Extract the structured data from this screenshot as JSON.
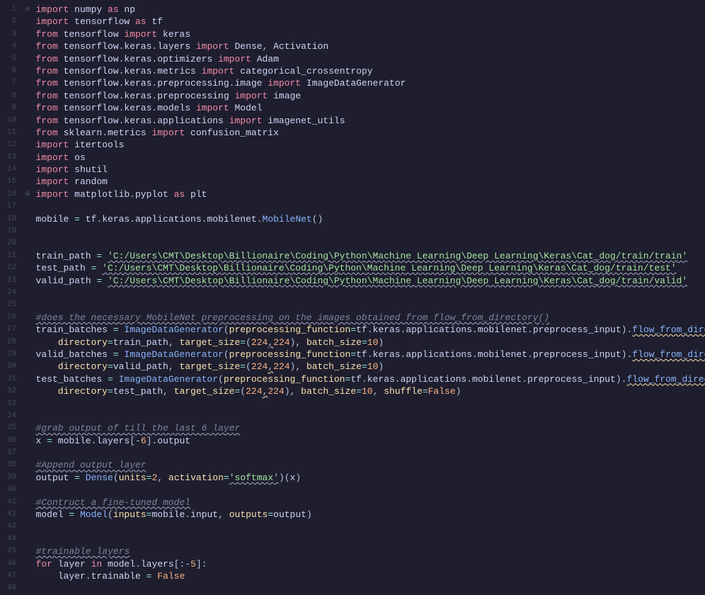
{
  "lines": [
    {
      "n": 1,
      "fold": "⊖",
      "html": "<span class='kw'>import</span> <span class='mod'>numpy</span> <span class='kw'>as</span> <span class='mod'>np</span>"
    },
    {
      "n": 2,
      "fold": "",
      "html": "<span class='kw'>import</span> <span class='mod'>tensorflow</span> <span class='kw'>as</span> <span class='mod'>tf</span>"
    },
    {
      "n": 3,
      "fold": "",
      "html": "<span class='kw'>from</span> <span class='mod'>tensorflow</span> <span class='kw'>import</span> <span class='mod'>keras</span>"
    },
    {
      "n": 4,
      "fold": "",
      "html": "<span class='kw'>from</span> <span class='mod'>tensorflow</span><span class='punc'>.</span><span class='mod'>keras</span><span class='punc'>.</span><span class='mod'>layers</span> <span class='kw'>import</span> <span class='mod'>Dense</span><span class='punc'>,</span> <span class='mod'>Activation</span>"
    },
    {
      "n": 5,
      "fold": "",
      "html": "<span class='kw'>from</span> <span class='mod'>tensorflow</span><span class='punc'>.</span><span class='mod'>keras</span><span class='punc'>.</span><span class='mod'>optimizers</span> <span class='kw'>import</span> <span class='mod'>Adam</span>"
    },
    {
      "n": 6,
      "fold": "",
      "html": "<span class='kw'>from</span> <span class='mod'>tensorflow</span><span class='punc'>.</span><span class='mod'>keras</span><span class='punc'>.</span><span class='mod'>metrics</span> <span class='kw'>import</span> <span class='mod'>categorical_crossentropy</span>"
    },
    {
      "n": 7,
      "fold": "",
      "html": "<span class='kw'>from</span> <span class='mod'>tensorflow</span><span class='punc'>.</span><span class='mod'>keras</span><span class='punc'>.</span><span class='mod'>preprocessing</span><span class='punc'>.</span><span class='mod'>image</span> <span class='kw'>import</span> <span class='mod'>ImageDataGenerator</span>"
    },
    {
      "n": 8,
      "fold": "",
      "html": "<span class='kw'>from</span> <span class='mod'>tensorflow</span><span class='punc'>.</span><span class='mod'>keras</span><span class='punc'>.</span><span class='mod'>preprocessing</span> <span class='kw'>import</span> <span class='mod'>image</span>"
    },
    {
      "n": 9,
      "fold": "",
      "html": "<span class='kw'>from</span> <span class='mod'>tensorflow</span><span class='punc'>.</span><span class='mod'>keras</span><span class='punc'>.</span><span class='mod'>models</span> <span class='kw'>import</span> <span class='mod'>Model</span>"
    },
    {
      "n": 10,
      "fold": "",
      "html": "<span class='kw'>from</span> <span class='mod'>tensorflow</span><span class='punc'>.</span><span class='mod'>keras</span><span class='punc'>.</span><span class='mod'>applications</span> <span class='kw'>import</span> <span class='mod'>imagenet_utils</span>"
    },
    {
      "n": 11,
      "fold": "",
      "html": "<span class='kw'>from</span> <span class='mod'>sklearn</span><span class='punc'>.</span><span class='mod'>metrics</span> <span class='kw'>import</span> <span class='mod'>confusion_matrix</span>"
    },
    {
      "n": 12,
      "fold": "",
      "html": "<span class='kw'>import</span> <span class='mod'>itertools</span>"
    },
    {
      "n": 13,
      "fold": "",
      "html": "<span class='kw'>import</span> <span class='mod'>os</span>"
    },
    {
      "n": 14,
      "fold": "",
      "html": "<span class='kw'>import</span> <span class='mod'>shutil</span>"
    },
    {
      "n": 15,
      "fold": "",
      "html": "<span class='kw'>import</span> <span class='mod'>random</span>"
    },
    {
      "n": 16,
      "fold": "⊖",
      "html": "<span class='kw'>import</span> <span class='mod'>matplotlib</span><span class='punc'>.</span><span class='mod'>pyplot</span> <span class='kw'>as</span> <span class='mod'>plt</span>"
    },
    {
      "n": 17,
      "fold": "",
      "html": ""
    },
    {
      "n": 18,
      "fold": "",
      "html": "<span class='var'>mobile</span> <span class='op'>=</span> <span class='var'>tf</span><span class='punc'>.</span><span class='var'>keras</span><span class='punc'>.</span><span class='var'>applications</span><span class='punc'>.</span><span class='var'>mobilenet</span><span class='punc'>.</span><span class='fn'>MobileNet</span><span class='punc'>()</span>"
    },
    {
      "n": 19,
      "fold": "",
      "html": ""
    },
    {
      "n": 20,
      "fold": "",
      "html": ""
    },
    {
      "n": 21,
      "fold": "",
      "html": "<span class='var'>train_path</span> <span class='op'>=</span> <span class='str typo'>'C:/Users\\CMT\\Desktop\\Billionaire\\Coding\\Python\\Machine Learning\\Deep Learning\\Keras\\Cat_dog/train/train'</span>"
    },
    {
      "n": 22,
      "fold": "",
      "html": "<span class='var'>test_path</span> <span class='op'>=</span> <span class='str typo'>'C:/Users\\CMT\\Desktop\\Billionaire\\Coding\\Python\\Machine Learning\\Deep Learning\\Keras\\Cat_dog/train/test'</span>"
    },
    {
      "n": 23,
      "fold": "",
      "html": "<span class='var'>valid_path</span> <span class='op'>=</span> <span class='str typo'>'C:/Users\\CMT\\Desktop\\Billionaire\\Coding\\Python\\Machine Learning\\Deep Learning\\Keras\\Cat_dog/train/valid'</span>"
    },
    {
      "n": 24,
      "fold": "",
      "html": ""
    },
    {
      "n": 25,
      "fold": "",
      "html": ""
    },
    {
      "n": 26,
      "fold": "",
      "html": "<span class='cmt typo'>#does the necessary MobileNet preprocessing on the images obtained from flow_from_directory()</span>"
    },
    {
      "n": 27,
      "fold": "",
      "html": "<span class='var'>train_batches</span> <span class='op'>=</span> <span class='fn'>ImageDataGenerator</span><span class='punc'>(</span><span class='param'>preprocessing_function</span><span class='op'>=</span><span class='var'>tf</span><span class='punc'>.</span><span class='var'>keras</span><span class='punc'>.</span><span class='var'>applications</span><span class='punc'>.</span><span class='var'>mobilenet</span><span class='punc'>.</span><span class='var'>preprocess_input</span><span class='punc'>).</span><span class='fn warn'>flow_from_directory</span><span class='punc'>(</span>"
    },
    {
      "n": 28,
      "fold": "",
      "html": "    <span class='param'>directory</span><span class='op'>=</span><span class='var'>train_path</span><span class='punc'>,</span> <span class='param'>target_size</span><span class='op'>=</span><span class='punc'>(</span><span class='num'>224</span><span class='punc warn'>,</span><span class='num'>224</span><span class='punc'>),</span> <span class='param'>batch_size</span><span class='op'>=</span><span class='num'>10</span><span class='punc'>)</span>"
    },
    {
      "n": 29,
      "fold": "",
      "html": "<span class='var'>valid_batches</span> <span class='op'>=</span> <span class='fn'>ImageDataGenerator</span><span class='punc'>(</span><span class='param'>preprocessing_function</span><span class='op'>=</span><span class='var'>tf</span><span class='punc'>.</span><span class='var'>keras</span><span class='punc'>.</span><span class='var'>applications</span><span class='punc'>.</span><span class='var'>mobilenet</span><span class='punc'>.</span><span class='var'>preprocess_input</span><span class='punc'>).</span><span class='fn warn'>flow_from_directory</span><span class='punc'>(</span>"
    },
    {
      "n": 30,
      "fold": "",
      "html": "    <span class='param'>directory</span><span class='op'>=</span><span class='var'>valid_path</span><span class='punc'>,</span> <span class='param'>target_size</span><span class='op'>=</span><span class='punc'>(</span><span class='num'>224</span><span class='punc warn'>,</span><span class='num'>224</span><span class='punc'>),</span> <span class='param'>batch_size</span><span class='op'>=</span><span class='num'>10</span><span class='punc'>)</span>"
    },
    {
      "n": 31,
      "fold": "",
      "html": "<span class='var'>test_batches</span> <span class='op'>=</span> <span class='fn'>ImageDataGenerator</span><span class='punc'>(</span><span class='param'>preprocessing_function</span><span class='op'>=</span><span class='var'>tf</span><span class='punc'>.</span><span class='var'>keras</span><span class='punc'>.</span><span class='var'>applications</span><span class='punc'>.</span><span class='var'>mobilenet</span><span class='punc'>.</span><span class='var'>preprocess_input</span><span class='punc'>).</span><span class='fn warn'>flow_from_directory</span><span class='punc'>(</span>"
    },
    {
      "n": 32,
      "fold": "",
      "html": "    <span class='param'>directory</span><span class='op'>=</span><span class='var'>test_path</span><span class='punc'>,</span> <span class='param'>target_size</span><span class='op'>=</span><span class='punc'>(</span><span class='num'>224</span><span class='punc warn'>,</span><span class='num'>224</span><span class='punc'>),</span> <span class='param'>batch_size</span><span class='op'>=</span><span class='num'>10</span><span class='punc'>,</span> <span class='param'>shuffle</span><span class='op'>=</span><span class='bool'>False</span><span class='punc'>)</span>"
    },
    {
      "n": 33,
      "fold": "",
      "html": ""
    },
    {
      "n": 34,
      "fold": "",
      "html": ""
    },
    {
      "n": 35,
      "fold": "",
      "html": "<span class='cmt typo'>#grab output of till the last 6 layer</span>"
    },
    {
      "n": 36,
      "fold": "",
      "html": "<span class='var'>x</span> <span class='op'>=</span> <span class='var'>mobile</span><span class='punc'>.</span><span class='var'>layers</span><span class='punc'>[</span><span class='op'>-</span><span class='num'>6</span><span class='punc'>].</span><span class='var'>output</span>"
    },
    {
      "n": 37,
      "fold": "",
      "html": ""
    },
    {
      "n": 38,
      "fold": "",
      "html": "<span class='cmt typo'>#Append output layer</span>"
    },
    {
      "n": 39,
      "fold": "",
      "html": "<span class='var'>output</span> <span class='op'>=</span> <span class='fn'>Dense</span><span class='punc'>(</span><span class='param'>units</span><span class='op'>=</span><span class='num'>2</span><span class='punc'>,</span> <span class='param'>activation</span><span class='op'>=</span><span class='str typo'>'softmax'</span><span class='punc'>)(</span><span class='var'>x</span><span class='punc'>)</span>"
    },
    {
      "n": 40,
      "fold": "",
      "html": ""
    },
    {
      "n": 41,
      "fold": "",
      "html": "<span class='cmt typo'>#Contruct a fine-tuned model</span>"
    },
    {
      "n": 42,
      "fold": "",
      "html": "<span class='var'>model</span> <span class='op'>=</span> <span class='fn'>Model</span><span class='punc'>(</span><span class='param'>inputs</span><span class='op'>=</span><span class='var'>mobile</span><span class='punc'>.</span><span class='var'>input</span><span class='punc'>,</span> <span class='param'>outputs</span><span class='op'>=</span><span class='var'>output</span><span class='punc'>)</span>"
    },
    {
      "n": 43,
      "fold": "",
      "html": ""
    },
    {
      "n": 44,
      "fold": "",
      "html": ""
    },
    {
      "n": 45,
      "fold": "",
      "html": "<span class='cmt typo'>#trainable layers</span>"
    },
    {
      "n": 46,
      "fold": "",
      "html": "<span class='kw'>for</span> <span class='var'>layer</span> <span class='kw'>in</span> <span class='var'>model</span><span class='punc'>.</span><span class='var'>layers</span><span class='punc'>[:</span><span class='op'>-</span><span class='num'>5</span><span class='punc'>]:</span>"
    },
    {
      "n": 47,
      "fold": "",
      "html": "    <span class='var'>layer</span><span class='punc'>.</span><span class='var'>trainable</span> <span class='op'>=</span> <span class='bool'>False</span>"
    },
    {
      "n": 48,
      "fold": "",
      "html": ""
    }
  ]
}
